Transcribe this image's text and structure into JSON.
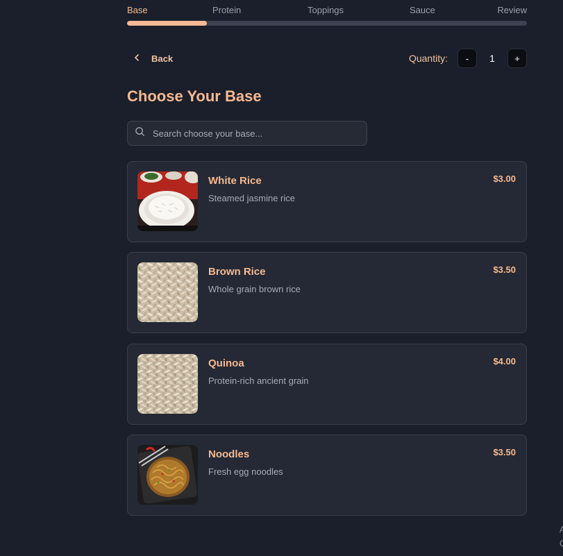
{
  "steps": [
    {
      "label": "Base",
      "active": true
    },
    {
      "label": "Protein",
      "active": false
    },
    {
      "label": "Toppings",
      "active": false
    },
    {
      "label": "Sauce",
      "active": false
    },
    {
      "label": "Review",
      "active": false
    }
  ],
  "progress": {
    "percent": 20
  },
  "nav": {
    "back_label": "Back"
  },
  "quantity": {
    "label": "Quantity:",
    "minus": "-",
    "value": "1",
    "plus": "+"
  },
  "page_title": "Choose Your Base",
  "search": {
    "placeholder": "Search choose your base..."
  },
  "items": [
    {
      "name": "White Rice",
      "description": "Steamed jasmine rice",
      "price": "$3.00",
      "image": "white-rice-bowl"
    },
    {
      "name": "Brown Rice",
      "description": "Whole grain brown rice",
      "price": "$3.50",
      "image": "brown-rice-grains"
    },
    {
      "name": "Quinoa",
      "description": "Protein-rich ancient grain",
      "price": "$4.00",
      "image": "quinoa-grains"
    },
    {
      "name": "Noodles",
      "description": "Fresh egg noodles",
      "price": "$3.50",
      "image": "noodles-plate"
    }
  ],
  "edge": {
    "char1": "A",
    "char2": "C"
  },
  "colors": {
    "accent": "#f6b98f",
    "background": "#1a1f2b",
    "card": "#252935"
  }
}
